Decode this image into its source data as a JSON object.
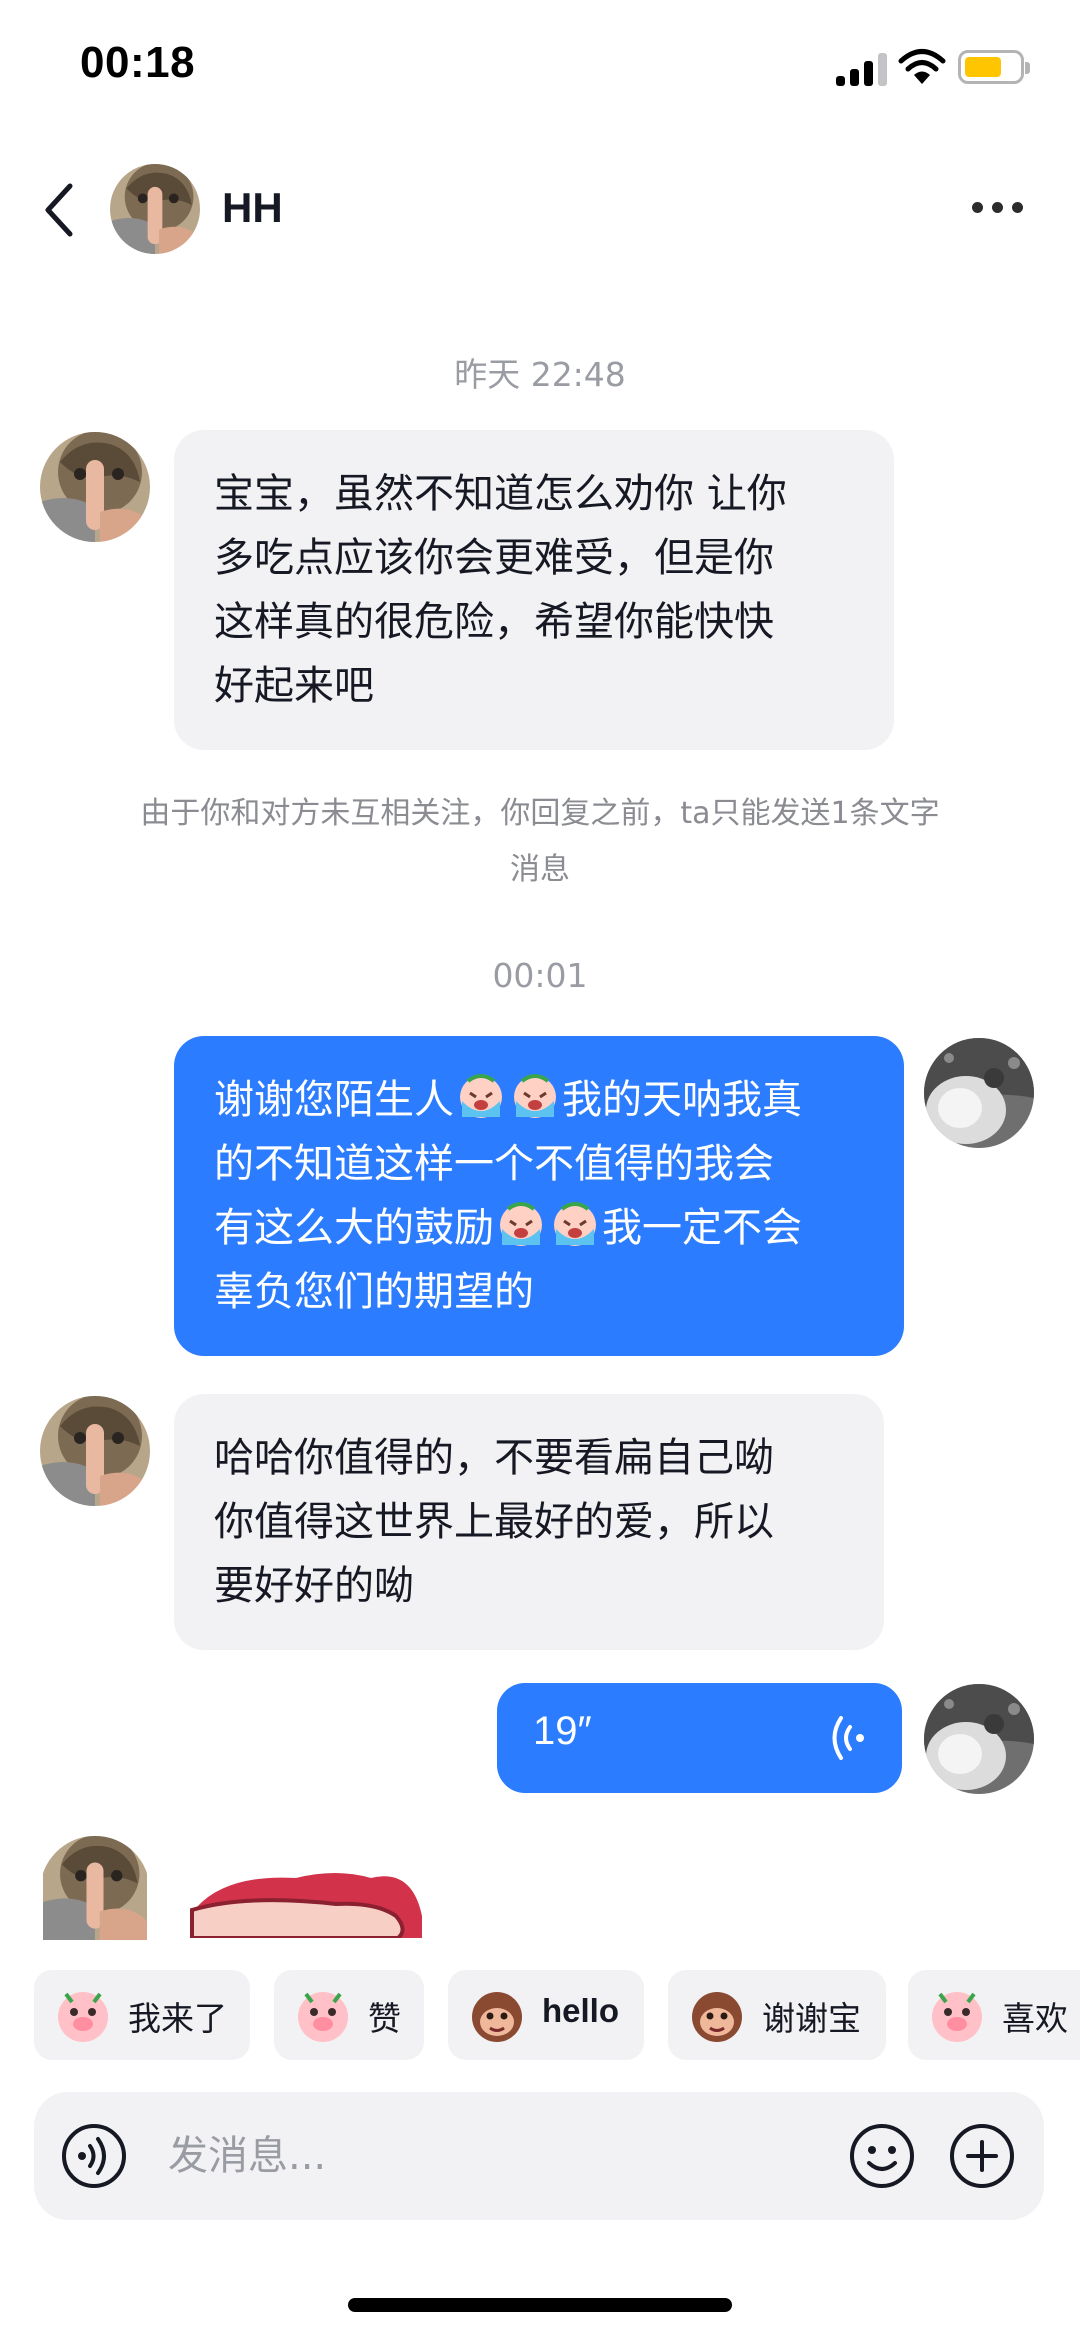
{
  "status_bar": {
    "time": "00:18",
    "battery_color": "#ffc500"
  },
  "header": {
    "contact_name": "HH",
    "back_icon": "chevron-left-icon",
    "more_icon": "more-dots-icon"
  },
  "messages": [
    {
      "type": "timestamp",
      "text": "昨天 22:48"
    },
    {
      "type": "text",
      "direction": "incoming",
      "lines": [
        "宝宝，虽然不知道怎么劝你 让你",
        "多吃点应该你会更难受，但是你",
        "这样真的很危险，希望你能快快",
        "好起来吧"
      ]
    },
    {
      "type": "notice",
      "lines": [
        "由于你和对方未互相关注，你回复之前，ta只能发送1条文字",
        "消息"
      ]
    },
    {
      "type": "timestamp",
      "text": "00:01"
    },
    {
      "type": "text",
      "direction": "outgoing",
      "segments": [
        "谢谢您陌生人",
        "我的天呐我真",
        "的不知道这样一个不值得的我会",
        "有这么大的鼓励",
        "我一定不会",
        "辜负您们的期望的"
      ],
      "emoji": "crying-face-emoji"
    },
    {
      "type": "text",
      "direction": "incoming",
      "lines": [
        "哈哈你值得的，不要看扁自己呦",
        "你值得这世界上最好的爱，所以",
        "要好好的呦"
      ]
    },
    {
      "type": "voice",
      "direction": "outgoing",
      "duration": "19″"
    },
    {
      "type": "sticker",
      "direction": "incoming"
    }
  ],
  "quick_replies": [
    {
      "label": "我来了",
      "icon": "pig-wave-sticker-icon"
    },
    {
      "label": "赞",
      "icon": "pig-thumbs-up-sticker-icon"
    },
    {
      "label": "hello",
      "icon": "monkey-hello-sticker-icon"
    },
    {
      "label": "谢谢宝",
      "icon": "monkey-thanks-sticker-icon"
    },
    {
      "label": "喜欢",
      "icon": "pig-love-sticker-icon"
    }
  ],
  "input_bar": {
    "placeholder": "发消息...",
    "voice_icon": "voice-toggle-icon",
    "emoji_icon": "smiley-icon",
    "plus_icon": "plus-icon"
  },
  "colors": {
    "outgoing_bubble": "#2b7cff",
    "incoming_bubble": "#f2f2f4",
    "timestamp_text": "#9a9ca3"
  }
}
